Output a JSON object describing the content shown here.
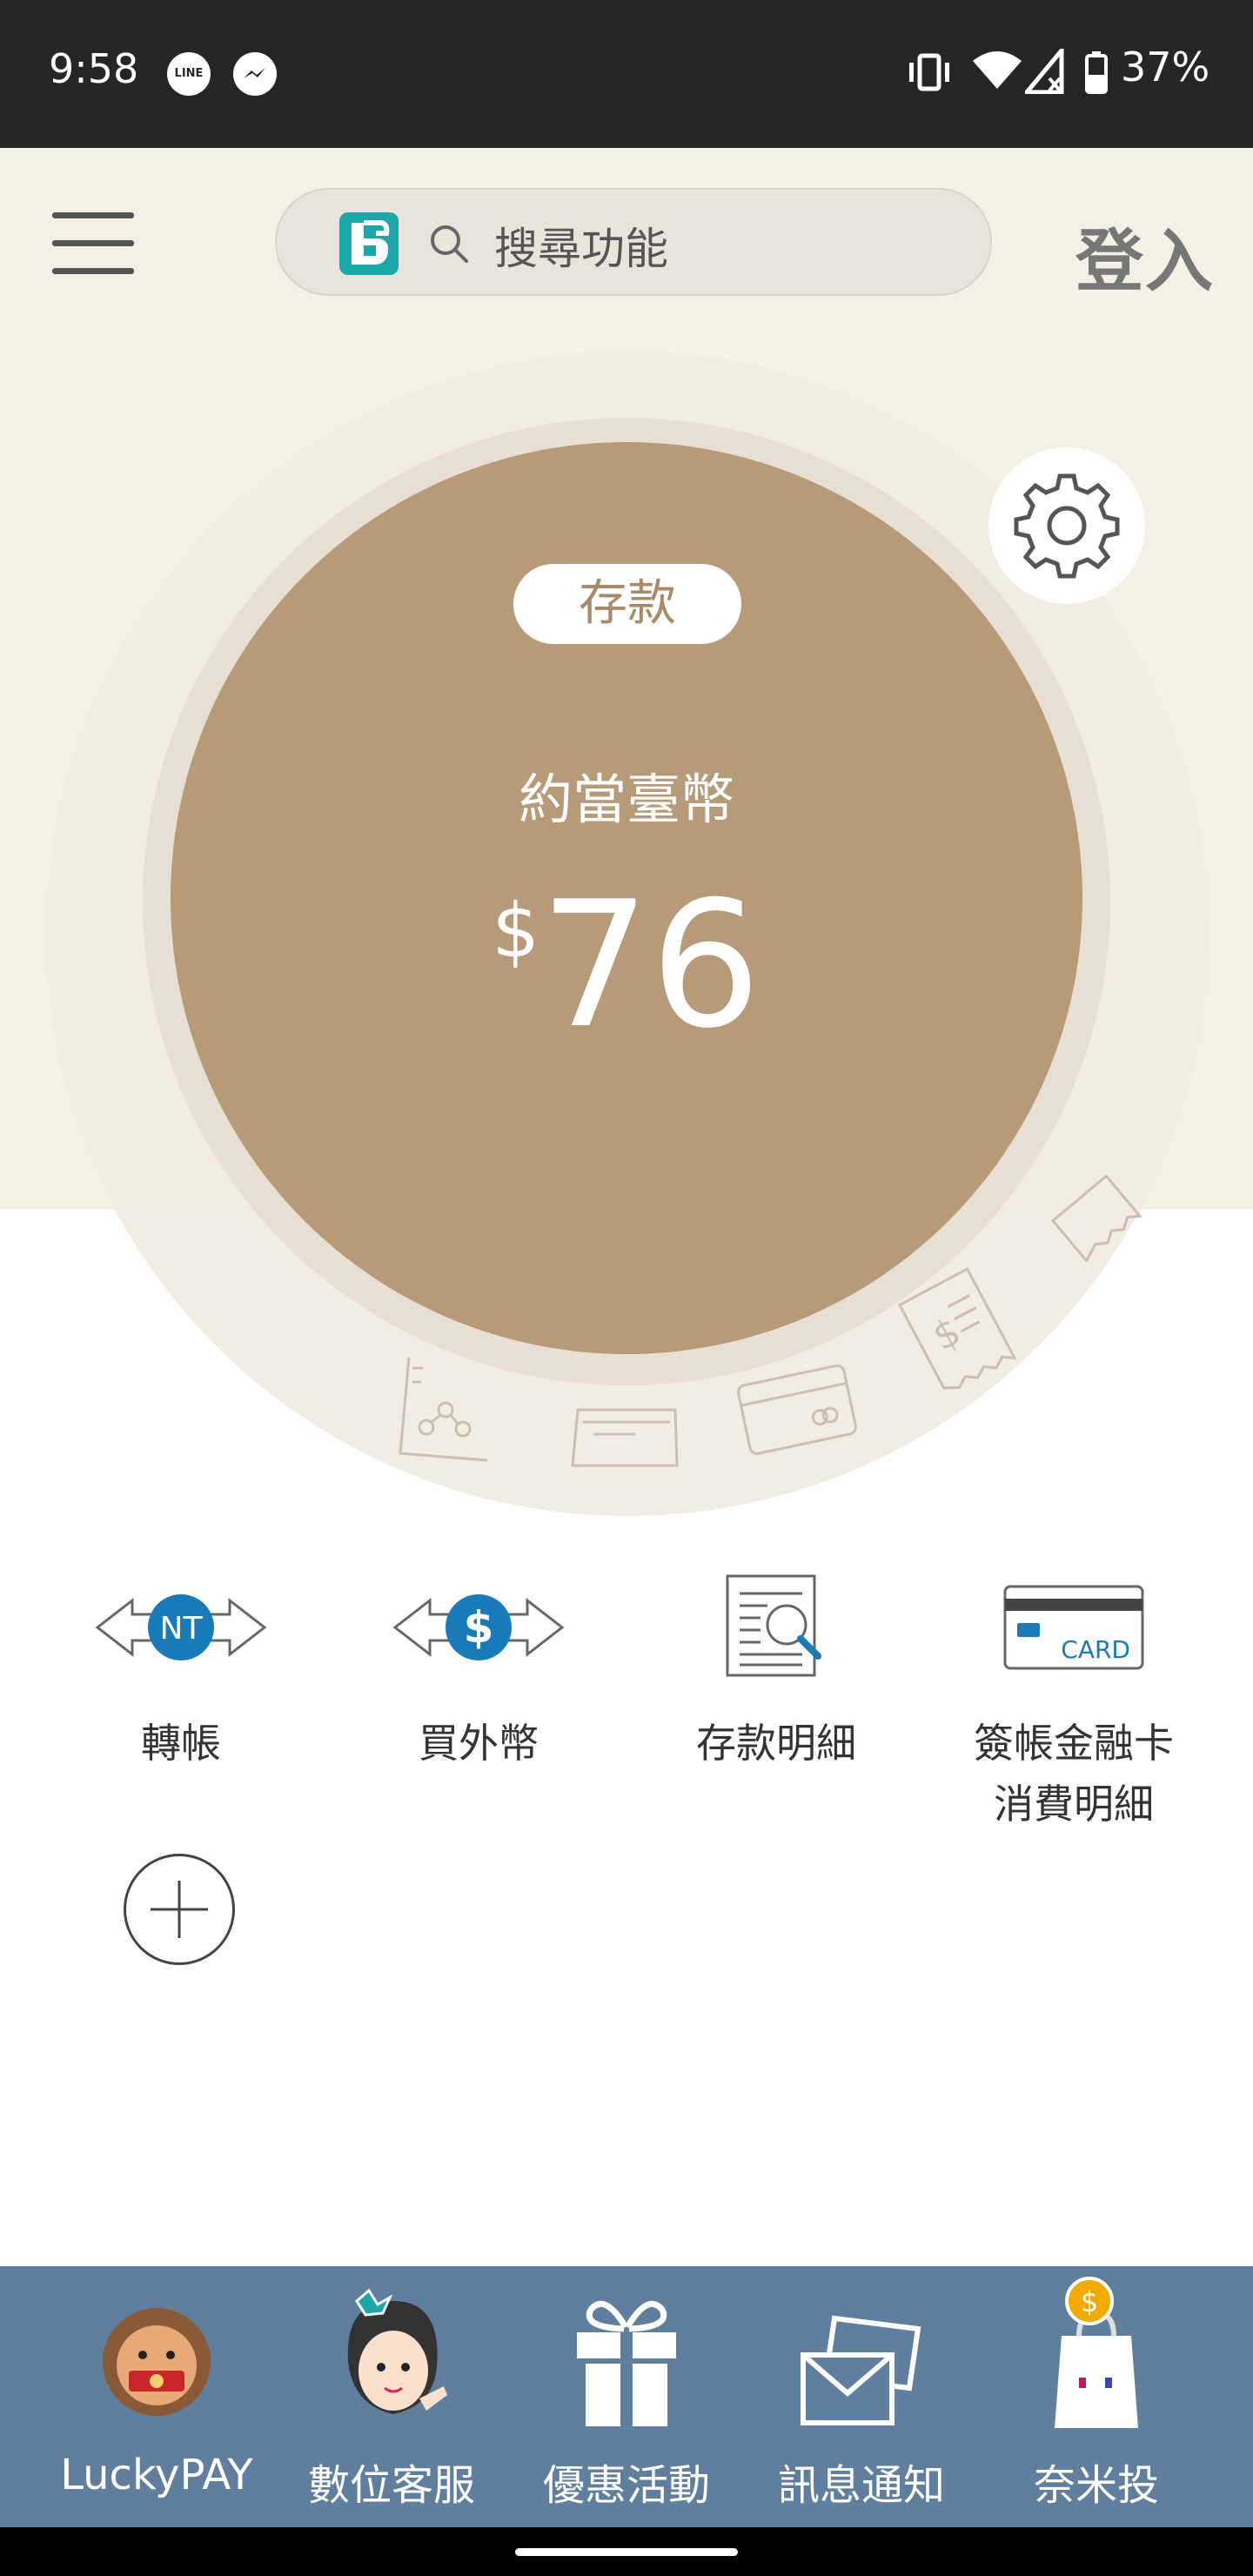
{
  "status_bar": {
    "time": "9:58",
    "line_icon": "LINE",
    "battery": "37%"
  },
  "header": {
    "search_placeholder": "搜尋功能",
    "login_label": "登入"
  },
  "balance": {
    "badge": "存款",
    "caption": "約當臺幣",
    "currency_symbol": "$",
    "amount": "76"
  },
  "quick_actions": [
    {
      "label": "轉帳",
      "icon": "nt-transfer-icon"
    },
    {
      "label": "買外幣",
      "icon": "buy-foreign-currency-icon"
    },
    {
      "label": "存款明細",
      "icon": "deposit-details-icon"
    },
    {
      "label_line1": "簽帳金融卡",
      "label_line2": "消費明細",
      "icon": "card-icon"
    }
  ],
  "card_icon_text": "CARD",
  "bottom_nav": [
    {
      "label": "LuckyPAY",
      "icon": "lion-mascot-icon"
    },
    {
      "label": "數位客服",
      "icon": "customer-service-avatar-icon"
    },
    {
      "label": "優惠活動",
      "icon": "gift-icon"
    },
    {
      "label": "訊息通知",
      "icon": "envelope-icon"
    },
    {
      "label": "奈米投",
      "icon": "nano-invest-bag-icon"
    }
  ],
  "colors": {
    "status_bar": "#262626",
    "header_bg": "#f4f0e6",
    "circle": "#b79a78",
    "accent_blue": "#1a7bb9",
    "bottom_nav": "#607e9e"
  }
}
